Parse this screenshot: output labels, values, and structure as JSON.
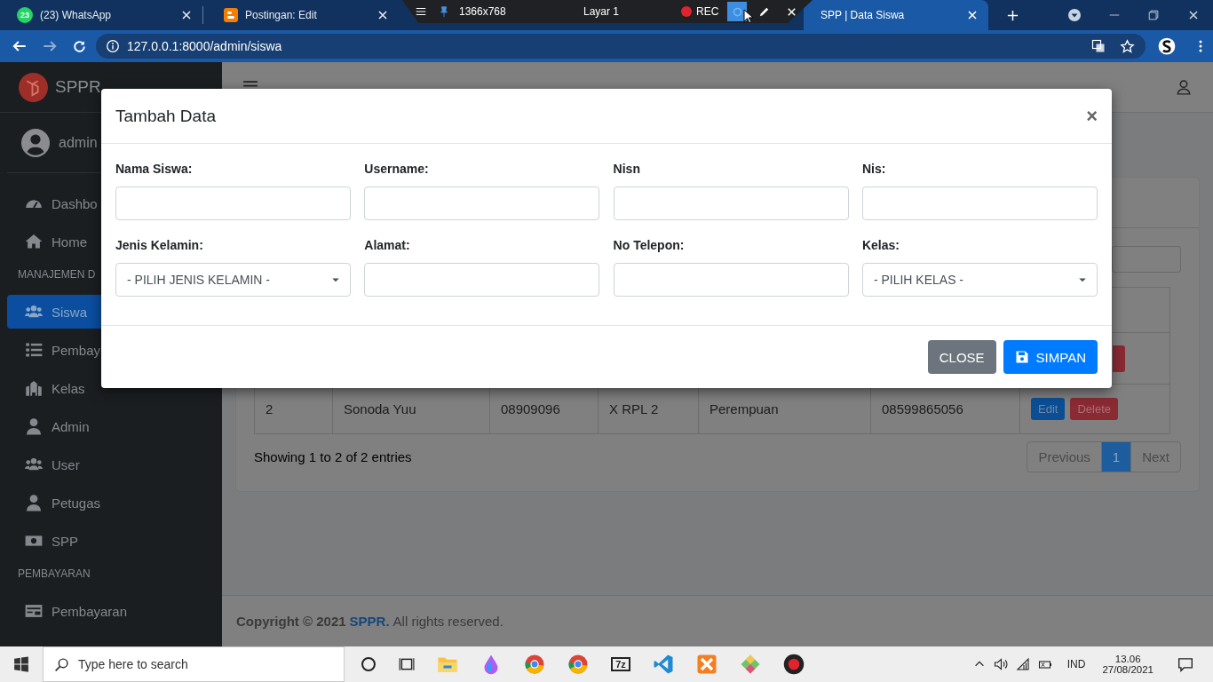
{
  "browser": {
    "tabs": [
      {
        "title": "(23) WhatsApp",
        "badge": "23",
        "selected": false
      },
      {
        "title": "Postingan: Edit",
        "selected": false
      },
      {
        "title": "SPP | Data Siswa",
        "selected": true
      }
    ],
    "url": "127.0.0.1:8000/admin/siswa"
  },
  "recorder": {
    "size": "1366x768",
    "layer": "Layar 1",
    "rec": "REC"
  },
  "sidebar": {
    "brand": "SPPR",
    "user": "admin",
    "items": [
      {
        "kind": "item",
        "label": "Dashbo",
        "selected": false
      },
      {
        "kind": "item",
        "label": "Home",
        "selected": false
      },
      {
        "kind": "header",
        "label": "MANAJEMEN D"
      },
      {
        "kind": "item",
        "label": "Siswa",
        "selected": true
      },
      {
        "kind": "item",
        "label": "Pembay",
        "selected": false
      },
      {
        "kind": "item",
        "label": "Kelas",
        "selected": false
      },
      {
        "kind": "item",
        "label": "Admin",
        "selected": false
      },
      {
        "kind": "item",
        "label": "User",
        "selected": false
      },
      {
        "kind": "item",
        "label": "Petugas",
        "selected": false
      },
      {
        "kind": "item",
        "label": "SPP",
        "selected": false
      },
      {
        "kind": "header",
        "label": "PEMBAYARAN"
      },
      {
        "kind": "item",
        "label": "Pembayaran",
        "selected": false
      }
    ]
  },
  "table": {
    "rows": [
      {
        "cells": [],
        "actions": []
      },
      {
        "cells": [
          "2",
          "Sonoda Yuu",
          "08909096",
          "X RPL 2",
          "Perempuan",
          "08599865056"
        ],
        "actions": [
          "Edit",
          "Delete"
        ]
      }
    ],
    "info": "Showing 1 to 2 of 2 entries",
    "pagination": [
      {
        "label": "Previous",
        "selected": false
      },
      {
        "label": "1",
        "selected": true
      },
      {
        "label": "Next",
        "selected": false
      }
    ]
  },
  "footer": {
    "copyright": "Copyright © 2021",
    "link": "SPPR.",
    "rest": "All rights reserved."
  },
  "modal": {
    "title": "Tambah Data",
    "close": "×",
    "fields": [
      {
        "label": "Nama Siswa:",
        "kind": "text"
      },
      {
        "label": "Username:",
        "kind": "text"
      },
      {
        "label": "Nisn",
        "kind": "text"
      },
      {
        "label": "Nis:",
        "kind": "text"
      },
      {
        "label": "Jenis Kelamin:",
        "kind": "select",
        "value": "- PILIH JENIS KELAMIN -"
      },
      {
        "label": "Alamat:",
        "kind": "text"
      },
      {
        "label": "No Telepon:",
        "kind": "text"
      },
      {
        "label": "Kelas:",
        "kind": "select",
        "value": "- PILIH KELAS -"
      }
    ],
    "buttons": [
      {
        "label": "CLOSE",
        "kind": "secondary"
      },
      {
        "label": "SIMPAN",
        "kind": "primary"
      }
    ]
  },
  "taskbar": {
    "search": {
      "placeholder": "Type here to search"
    },
    "apps": [
      {
        "kind": "folder"
      },
      {
        "kind": "droplet"
      },
      {
        "kind": "browser"
      },
      {
        "kind": "browser"
      },
      {
        "kind": "archive",
        "label": "7z"
      },
      {
        "kind": "editor"
      },
      {
        "kind": "cross"
      },
      {
        "kind": "diamond"
      },
      {
        "kind": "record"
      }
    ],
    "language": "IND",
    "time": "13.06",
    "date": "27/08/2021"
  }
}
